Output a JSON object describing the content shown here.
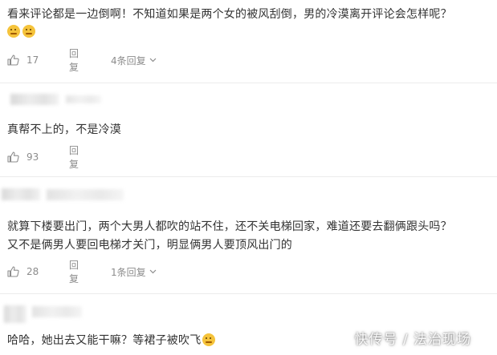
{
  "comments": [
    {
      "text": "看来评论都是一边倒啊！不知道如果是两个女的被风刮倒，男的冷漠离开评论会怎样呢？",
      "emojis": [
        "thinking-emoji",
        "thinking-emoji"
      ],
      "likes": "17",
      "reply_label": "回复",
      "more_replies": "4条回复"
    },
    {
      "text": "真帮不上的，不是冷漠",
      "likes": "93",
      "reply_label": "回复"
    },
    {
      "text_lines": [
        "就算下楼要出门，两个大男人都吹的站不住，还不关电梯回家，难道还要去翻俩跟头吗？",
        "又不是俩男人要回电梯才关门，明显俩男人要顶风出门的"
      ],
      "likes": "28",
      "reply_label": "回复",
      "more_replies": "1条回复"
    },
    {
      "text": "哈哈，她出去又能干嘛？等裙子被吹飞",
      "emojis": [
        "laughing-emoji"
      ]
    }
  ],
  "watermark": "快传号 / 法治现场",
  "colors": {
    "text": "#333333",
    "meta": "#8c8c8c",
    "divider": "#ececec",
    "emoji": "#f5c33b"
  }
}
